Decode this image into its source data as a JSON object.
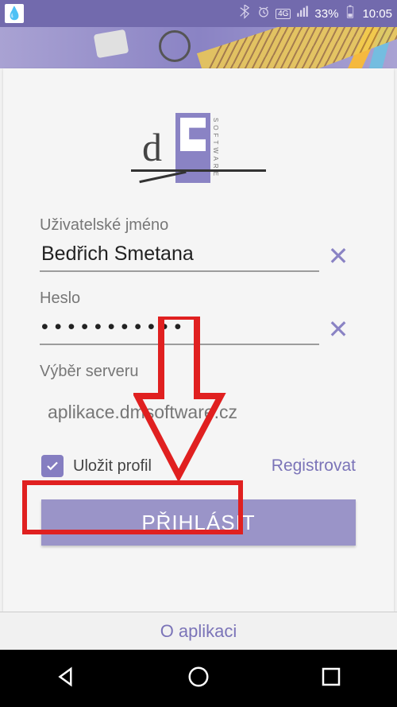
{
  "statusbar": {
    "battery_pct": "33%",
    "time": "10:05",
    "network_label": "4G"
  },
  "logo": {
    "text_d": "d",
    "software_text": "SOFTWARE"
  },
  "form": {
    "username_label": "Uživatelské jméno",
    "username_value": "Bedřich Smetana",
    "password_label": "Heslo",
    "password_value": "•••••••••••",
    "server_label": "Výběr serveru",
    "server_value": "aplikace.dmsoftware.cz",
    "save_profile_label": "Uložit profil",
    "register_label": "Registrovat",
    "login_label": "PŘIHLÁSIT"
  },
  "footer": {
    "about_label": "O aplikaci"
  },
  "colors": {
    "accent": "#8a83c4",
    "statusbar": "#726aad",
    "annotation": "#e02020"
  }
}
